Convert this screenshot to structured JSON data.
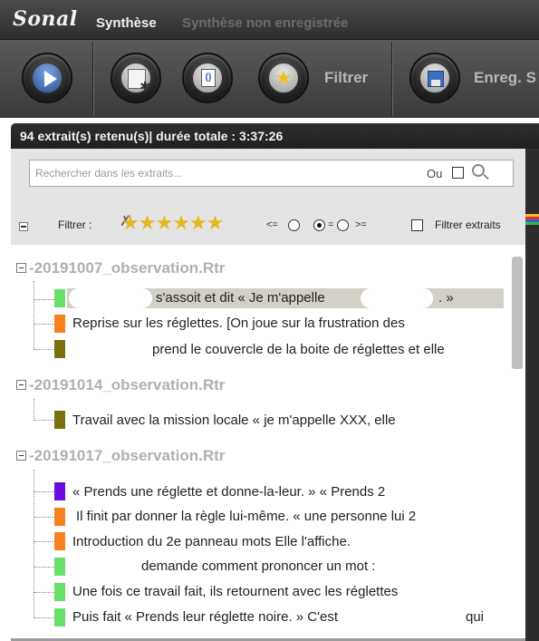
{
  "window": {
    "logo": "Sonal",
    "title": "Synthèse",
    "subtitle": "Synthèse non enregistrée"
  },
  "toolbar": {
    "buttons": [
      {
        "icon": "play-icon"
      },
      {
        "icon": "settings-document-icon"
      },
      {
        "icon": "document-icon",
        "glyph": "()"
      },
      {
        "icon": "star-filter-icon",
        "label": "Filtrer"
      },
      {
        "icon": "save-icon",
        "label": "Enreg. S"
      }
    ]
  },
  "panel": {
    "header": "94 extrait(s) retenu(s)| durée totale : 3:37:26",
    "search": {
      "placeholder": "Rechercher dans les extraits...",
      "value": "",
      "ou_label": "Ou",
      "ou_checked": false
    },
    "filter": {
      "label": "Filtrer :",
      "stars": "★★★★★★",
      "cmp_le": "<=",
      "cmp_eq": "=",
      "cmp_ge": ">=",
      "selected": "=",
      "extraits_label": "Filtrer extraits",
      "extraits_checked": false
    }
  },
  "tree": {
    "groups": [
      {
        "name": "-20191007_observation.Rtr",
        "items": [
          {
            "text": "s'assoit et dit « Je m'appelle",
            "text2": ". »",
            "color": "#66e066",
            "selected": true
          },
          {
            "text": "Reprise sur les réglettes. [On joue sur la frustration des",
            "color": "#f5821f"
          },
          {
            "text": "prend le couvercle de la boite de réglettes et elle",
            "color": "#7a7010"
          }
        ]
      },
      {
        "name": "-20191014_observation.Rtr",
        "items": [
          {
            "text": "Travail avec la mission locale « je m'appelle XXX, elle",
            "color": "#7a7010"
          }
        ]
      },
      {
        "name": "-20191017_observation.Rtr",
        "items": [
          {
            "text": "« Prends une réglette et donne-la-leur. » « Prends 2",
            "color": "#6a0ee0"
          },
          {
            "text": "Il finit par donner la règle lui-même. « une personne lui 2",
            "color": "#f5821f"
          },
          {
            "text": "Introduction du 2e panneau mots Elle l'affiche.",
            "color": "#f5821f"
          },
          {
            "text": "demande comment prononcer un mot :",
            "color": "#66e066"
          },
          {
            "text": "Une fois ce travail fait, ils retournent avec les réglettes",
            "color": "#66e066"
          },
          {
            "text": "Puis    fait « Prends leur réglette noire. » C'est",
            "text2": "qui",
            "color": "#66e066"
          }
        ]
      }
    ]
  },
  "colors": {
    "accent_strip": [
      "#f0c020",
      "#e03030",
      "#3060e0",
      "#30c030"
    ]
  }
}
